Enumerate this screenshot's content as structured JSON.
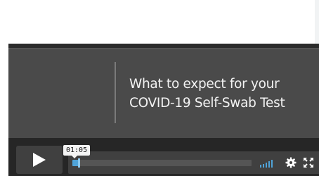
{
  "slide": {
    "title_line1": "What to expect for your",
    "title_line2": "COVID-19 Self-Swab Test"
  },
  "player": {
    "current_time": "01:05",
    "progress": 0.04,
    "volume_level": 1.0,
    "accent_color": "#4fa3d8",
    "icons": {
      "play": "play-icon",
      "volume": "volume-icon",
      "settings": "gear-icon",
      "fullscreen": "fullscreen-icon"
    }
  }
}
